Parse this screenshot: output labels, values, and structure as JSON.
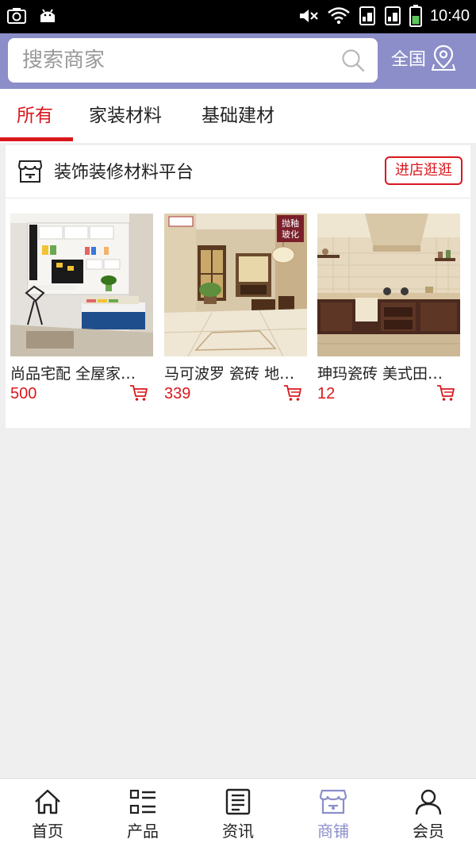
{
  "status_bar": {
    "time": "10:40",
    "icons": [
      "screenshot-icon",
      "android-icon",
      "mute-icon",
      "wifi-icon",
      "sim1-icon",
      "sim2-icon",
      "battery-icon"
    ]
  },
  "header": {
    "search_placeholder": "搜索商家",
    "region_label": "全国"
  },
  "tabs": [
    {
      "label": "所有",
      "active": true
    },
    {
      "label": "家装材料",
      "active": false
    },
    {
      "label": "基础建材",
      "active": false
    }
  ],
  "shop": {
    "name": "装饰装修材料平台",
    "visit_label": "进店逛逛",
    "products": [
      {
        "name": "尚品宅配 全屋家…",
        "price": "500"
      },
      {
        "name": "马可波罗 瓷砖 地…",
        "price": "339"
      },
      {
        "name": "珅玛瓷砖 美式田…",
        "price": "12"
      }
    ]
  },
  "product_badge": "抛釉玻化",
  "bottom_nav": [
    {
      "label": "首页",
      "icon": "home-icon",
      "active": false
    },
    {
      "label": "产品",
      "icon": "list-icon",
      "active": false
    },
    {
      "label": "资讯",
      "icon": "news-icon",
      "active": false
    },
    {
      "label": "商铺",
      "icon": "store-icon",
      "active": true
    },
    {
      "label": "会员",
      "icon": "user-icon",
      "active": false
    }
  ],
  "colors": {
    "accent": "#d9181e",
    "brand": "#8b8ec9"
  }
}
